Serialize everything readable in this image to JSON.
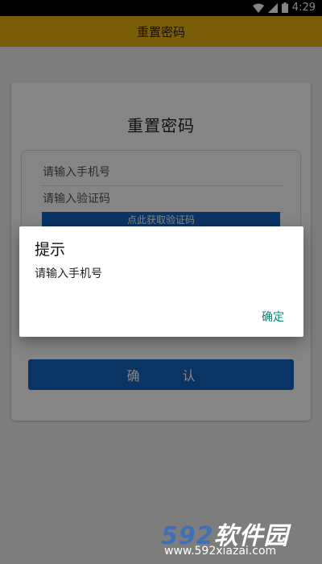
{
  "status_bar": {
    "time": "4:29"
  },
  "app_bar": {
    "title": "重置密码"
  },
  "card": {
    "title": "重置密码",
    "phone_placeholder": "请输入手机号",
    "code_placeholder": "请输入验证码",
    "get_code_label": "点此获取验证码",
    "confirm_label": "确 认"
  },
  "dialog": {
    "title": "提示",
    "message": "请输入手机号",
    "ok_label": "确定"
  },
  "watermark": {
    "logo_number": "592",
    "logo_text": "软件园",
    "url": "www.592xiazai.com"
  },
  "colors": {
    "app_bar": "#e8b40f",
    "primary_button": "#1565c0",
    "dialog_action": "#00897b",
    "scrim": "rgba(0,0,0,0.48)"
  },
  "icons": [
    "wifi-icon",
    "cellular-signal-icon",
    "battery-icon"
  ]
}
